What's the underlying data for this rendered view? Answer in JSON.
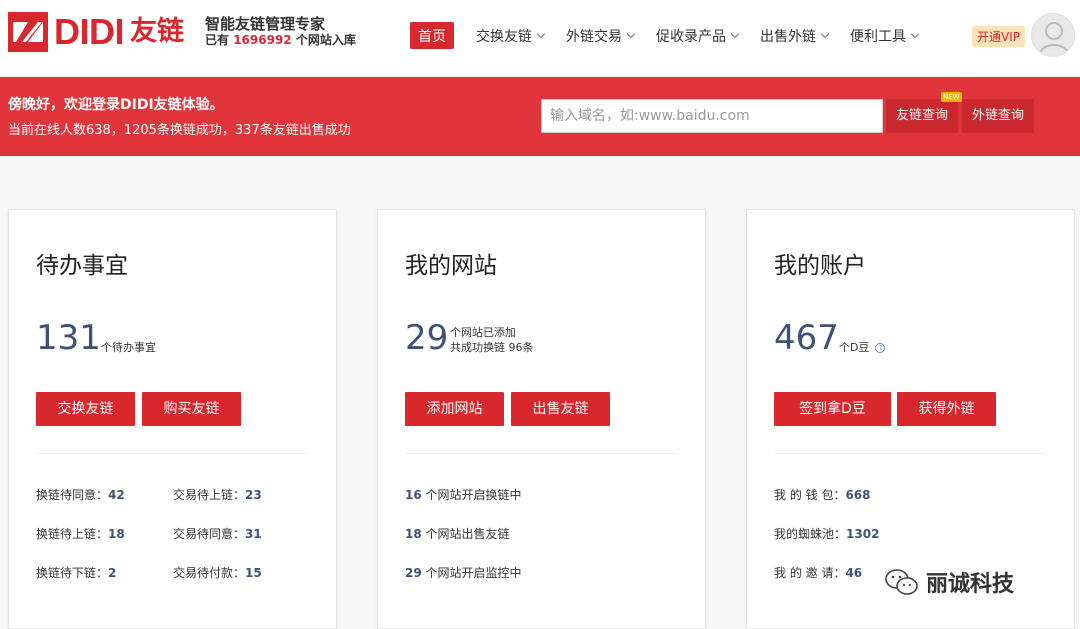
{
  "header": {
    "logo_text": "DIDI",
    "logo_cn": "友链",
    "slogan_line1": "智能友链管理专家",
    "slogan_prefix": "已有",
    "slogan_count": "1696992",
    "slogan_suffix": "个网站入库",
    "nav": [
      {
        "label": "首页",
        "active": true
      },
      {
        "label": "交换友链"
      },
      {
        "label": "外链交易"
      },
      {
        "label": "促收录产品"
      },
      {
        "label": "出售外链"
      },
      {
        "label": "便利工具"
      }
    ],
    "vip_label": "开通VIP",
    "brand_color": "#d8282e"
  },
  "banner": {
    "greeting": "傍晚好，欢迎登录DIDI友链体验。",
    "stats_line": "当前在线人数638，1205条换链成功，337条友链出售成功",
    "search_placeholder": "输入域名，如:www.baidu.com",
    "query_links_label": "友链查询",
    "query_external_label": "外链查询",
    "new_badge": "NEW"
  },
  "cards": {
    "todo": {
      "title": "待办事宜",
      "count": "131",
      "count_desc": "个待办事宜",
      "btn1": "交换友链",
      "btn2": "购买友链",
      "stats": [
        {
          "label": "换链待同意：",
          "value": "42"
        },
        {
          "label": "交易待上链：",
          "value": "23"
        },
        {
          "label": "换链待上链：",
          "value": "18"
        },
        {
          "label": "交易待同意：",
          "value": "31"
        },
        {
          "label": "换链待下链：",
          "value": "2"
        },
        {
          "label": "交易待付款：",
          "value": "15"
        }
      ]
    },
    "sites": {
      "title": "我的网站",
      "count": "29",
      "desc1": "个网站已添加",
      "desc2": "共成功换链 96条",
      "btn1": "添加网站",
      "btn2": "出售友链",
      "stats": [
        {
          "value": "16",
          "label": " 个网站开启换链中"
        },
        {
          "value": "18",
          "label": " 个网站出售友链"
        },
        {
          "value": "29",
          "label": " 个网站开启监控中"
        }
      ]
    },
    "account": {
      "title": "我的账户",
      "count": "467",
      "count_desc": "个D豆",
      "btn1": "签到拿D豆",
      "btn2": "获得外链",
      "stats": [
        {
          "label": "我 的 钱 包：",
          "value": "668"
        },
        {
          "label": "我的蜘蛛池：",
          "value": "1302"
        },
        {
          "label": "我 的 邀 请：",
          "value": "46"
        }
      ]
    }
  },
  "watermark": {
    "text": "丽诚科技",
    "icon": "wechat-icon"
  }
}
